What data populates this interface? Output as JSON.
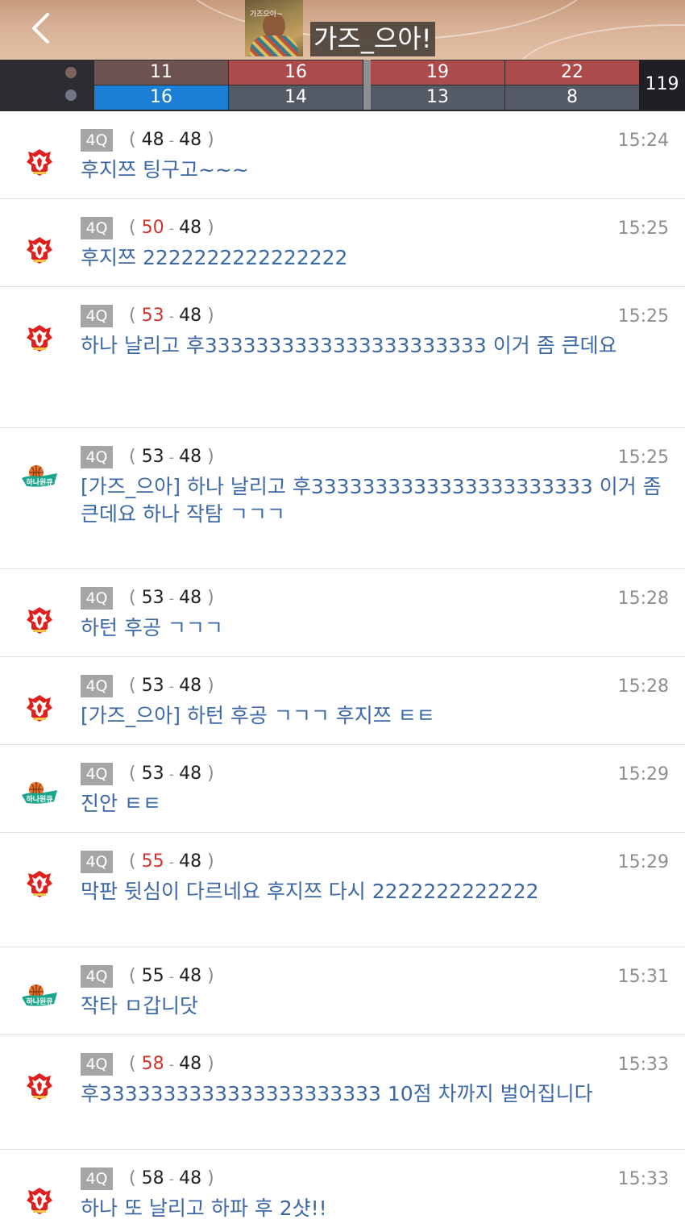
{
  "header": {
    "title": "가즈_으아!",
    "avatar_caption": "가즈으아~",
    "back_icon": "chevron-left-icon"
  },
  "scoreboard": {
    "home_color": "#7d6460",
    "away_color": "#707683",
    "quarters": [
      {
        "home": "11",
        "away": "16",
        "home_bg": "#6d5450",
        "away_bg": "#1b7fd6"
      },
      {
        "home": "16",
        "away": "14",
        "home_bg": "#ac4b4b",
        "away_bg": "#545a66"
      },
      {
        "home": "19",
        "away": "13",
        "home_bg": "#ac4b4b",
        "away_bg": "#545a66"
      },
      {
        "home": "22",
        "away": "8",
        "home_bg": "#ac4b4b",
        "away_bg": "#545a66"
      }
    ],
    "total": "119"
  },
  "messages": [
    {
      "team": "red-phoenix",
      "quarter": "4Q",
      "home_score": "48",
      "away_score": "48",
      "home_highlight": false,
      "time": "15:24",
      "text": "후지쯔 팅구고~~~"
    },
    {
      "team": "red-phoenix",
      "quarter": "4Q",
      "home_score": "50",
      "away_score": "48",
      "home_highlight": true,
      "time": "15:25",
      "text": "후지쯔 2222222222222222"
    },
    {
      "team": "red-phoenix",
      "quarter": "4Q",
      "home_score": "53",
      "away_score": "48",
      "home_highlight": true,
      "time": "15:25",
      "text": "하나 날리고 후3333333333333333333333 이거 좀 큰데요"
    },
    {
      "team": "hana-1q",
      "quarter": "4Q",
      "home_score": "53",
      "away_score": "48",
      "home_highlight": false,
      "time": "15:25",
      "text": "[가즈_으아] 하나 날리고 후3333333333333333333333 이거 좀 큰데요 하나 작탐 ㄱㄱㄱ"
    },
    {
      "team": "red-phoenix",
      "quarter": "4Q",
      "home_score": "53",
      "away_score": "48",
      "home_highlight": false,
      "time": "15:28",
      "text": "하턴 후공 ㄱㄱㄱ"
    },
    {
      "team": "red-phoenix",
      "quarter": "4Q",
      "home_score": "53",
      "away_score": "48",
      "home_highlight": false,
      "time": "15:28",
      "text": "[가즈_으아] 하턴 후공 ㄱㄱㄱ 후지쯔 ㅌㅌ"
    },
    {
      "team": "hana-1q",
      "quarter": "4Q",
      "home_score": "53",
      "away_score": "48",
      "home_highlight": false,
      "time": "15:29",
      "text": "진안 ㅌㅌ"
    },
    {
      "team": "red-phoenix",
      "quarter": "4Q",
      "home_score": "55",
      "away_score": "48",
      "home_highlight": true,
      "time": "15:29",
      "text": "막판 뒷심이 다르네요 후지쯔 다시 2222222222222"
    },
    {
      "team": "hana-1q",
      "quarter": "4Q",
      "home_score": "55",
      "away_score": "48",
      "home_highlight": false,
      "time": "15:31",
      "text": "작타 ㅁ갑니닷"
    },
    {
      "team": "red-phoenix",
      "quarter": "4Q",
      "home_score": "58",
      "away_score": "48",
      "home_highlight": true,
      "time": "15:33",
      "text": "후3333333333333333333333 10점 차까지 벌어집니다"
    },
    {
      "team": "red-phoenix",
      "quarter": "4Q",
      "home_score": "58",
      "away_score": "48",
      "home_highlight": false,
      "time": "15:33",
      "text": "하나 또 날리고 하파 후 2샷!!"
    }
  ],
  "colors": {
    "message_text": "#3c68a6",
    "score_highlight": "#d0342c",
    "quarter_badge": "#a5a5a8"
  }
}
